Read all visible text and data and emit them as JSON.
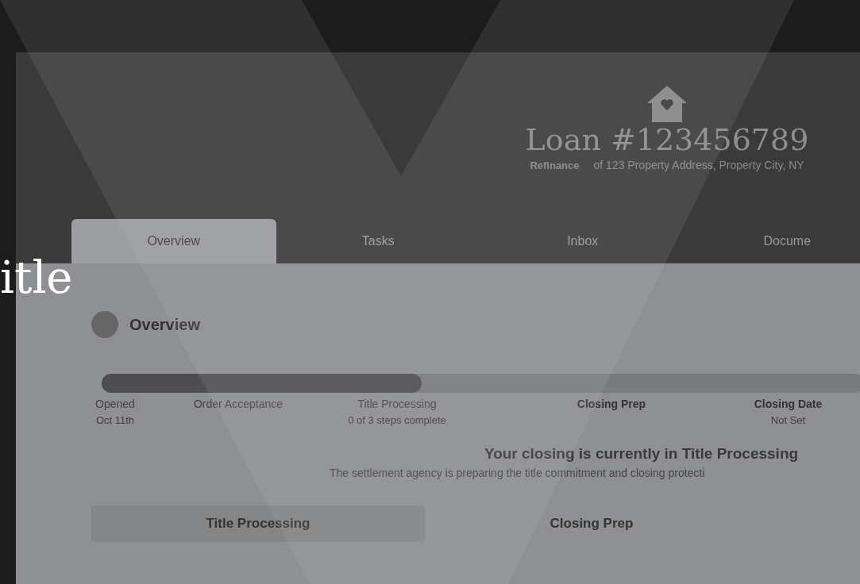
{
  "overlay_text": "itle",
  "header": {
    "title": "Loan #123456789",
    "loan_type": "Refinance",
    "address": "of 123 Property Address, Property City, NY"
  },
  "tabs": [
    {
      "label": "Overview",
      "selected": true
    },
    {
      "label": "Tasks",
      "selected": false
    },
    {
      "label": "Inbox",
      "selected": false
    },
    {
      "label": "Docume",
      "selected": false
    }
  ],
  "section_title": "Overview",
  "progress": {
    "level": 0.42,
    "steps": [
      {
        "label": "Opened",
        "sub": "Oct 11th",
        "done": true
      },
      {
        "label": "Order Acceptance",
        "done": true
      },
      {
        "label": "Title Processing",
        "sub": "0 of 3 steps complete",
        "done": true
      },
      {
        "label": "Closing Prep",
        "done": false
      },
      {
        "label": "Closing Date",
        "sub": "Not Set",
        "done": false
      }
    ]
  },
  "status": {
    "heading": "Your closing is currently in Title Processing",
    "text": "The settlement agency is preparing the title commitment and closing protecti"
  },
  "stages": [
    {
      "label": "Title Processing",
      "selected": true
    },
    {
      "label": "Closing Prep",
      "selected": false
    }
  ]
}
